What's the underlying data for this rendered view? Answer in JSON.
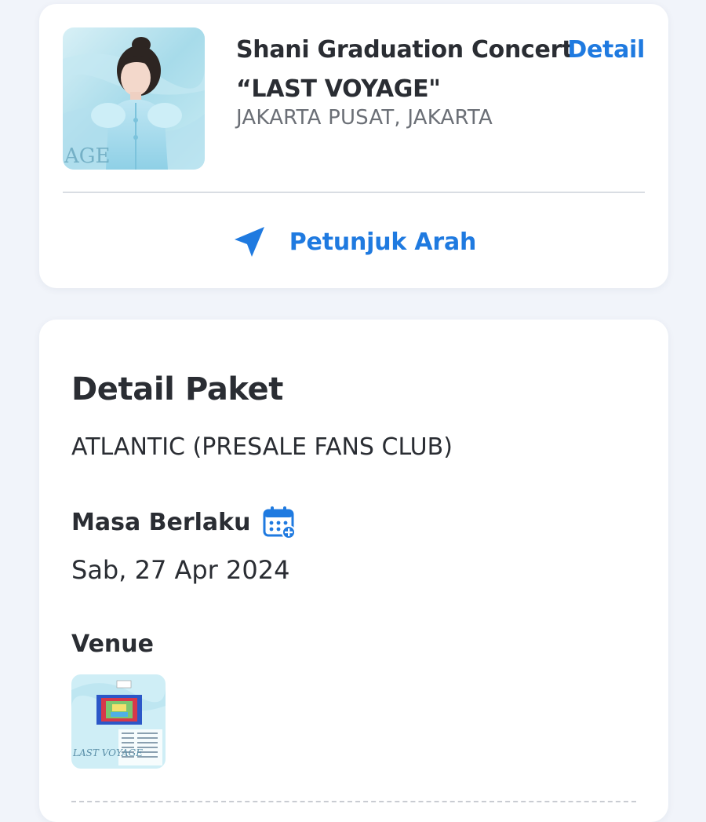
{
  "event": {
    "title_line1": "Shani Graduation Concert",
    "title_line2": "“LAST VOYAGE\"",
    "detail_link": "Detail",
    "location": "JAKARTA PUSAT, JAKARTA",
    "poster_text": "AGE",
    "directions_label": "Petunjuk Arah"
  },
  "package": {
    "section_title": "Detail Paket",
    "name": "ATLANTIC (PRESALE FANS CLUB)",
    "validity_label": "Masa Berlaku",
    "validity_date": "Sab, 27 Apr 2024",
    "venue_label": "Venue",
    "venue_map_text": "LAST VOYAGE"
  },
  "colors": {
    "accent": "#1f7ae0",
    "background": "#f1f4fa",
    "card": "#ffffff"
  },
  "icons": {
    "directions": "navigation-arrow-icon",
    "calendar": "calendar-add-icon"
  }
}
